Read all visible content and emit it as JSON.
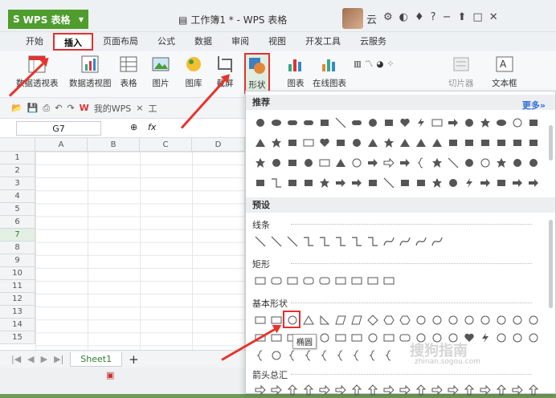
{
  "titlebar": {
    "app_name": "WPS 表格",
    "doc_title": "工作簿1 * - WPS 表格",
    "cloud_label": "云"
  },
  "tabs": [
    {
      "label": "开始"
    },
    {
      "label": "插入",
      "active": true
    },
    {
      "label": "页面布局"
    },
    {
      "label": "公式"
    },
    {
      "label": "数据"
    },
    {
      "label": "审阅"
    },
    {
      "label": "视图"
    },
    {
      "label": "开发工具"
    },
    {
      "label": "云服务"
    }
  ],
  "ribbon": {
    "pivot_table": "数据透视表",
    "pivot_chart": "数据透视图",
    "table": "表格",
    "picture": "图片",
    "gallery": "图库",
    "screenshot": "截屏",
    "shapes": "形状",
    "chart": "图表",
    "online_chart": "在线图表",
    "slicer": "切片器",
    "textbox": "文本框"
  },
  "qbar": {
    "my_wps": "我的WPS",
    "tab2": "工"
  },
  "formula": {
    "cell_ref": "G7",
    "fx": "fx"
  },
  "grid": {
    "columns": [
      "A",
      "B",
      "C",
      "D"
    ],
    "rows": [
      "1",
      "2",
      "3",
      "4",
      "5",
      "6",
      "7",
      "8",
      "9",
      "10",
      "11",
      "12",
      "13",
      "14",
      "15"
    ],
    "selected_row": "7"
  },
  "sheetbar": {
    "sheet_name": "Sheet1",
    "add": "+"
  },
  "panel": {
    "recommended": "推荐",
    "more": "更多",
    "presets": "预设",
    "lines": "线条",
    "rectangles": "矩形",
    "basic_shapes": "基本形状",
    "arrows": "箭头总汇",
    "tooltip": "椭圆"
  },
  "watermark": {
    "text": "搜狗指南",
    "url": "zhinan.sogou.com"
  }
}
